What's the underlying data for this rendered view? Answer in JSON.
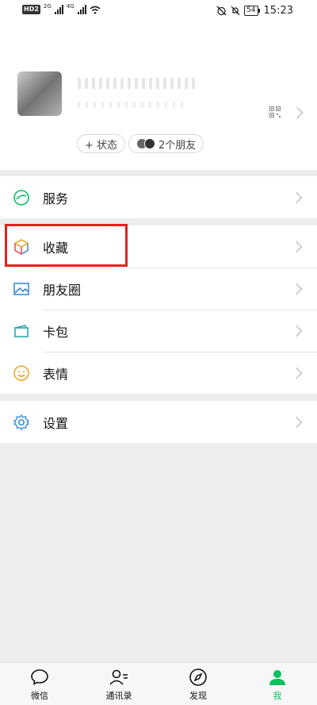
{
  "status_bar": {
    "hd": "HD",
    "hd_num": "2",
    "net1": "2G",
    "net2": "4G",
    "battery": "54",
    "time": "15:23"
  },
  "profile": {
    "status_chip": "+ 状态",
    "friends_chip": "2个朋友"
  },
  "menu": {
    "services": "服务",
    "favorites": "收藏",
    "moments": "朋友圈",
    "cards": "卡包",
    "stickers": "表情",
    "settings": "设置"
  },
  "tabs": [
    {
      "label": "微信",
      "icon": "chat-bubble-icon"
    },
    {
      "label": "通讯录",
      "icon": "contacts-icon"
    },
    {
      "label": "发现",
      "icon": "compass-icon"
    },
    {
      "label": "我",
      "icon": "person-icon",
      "active": true
    }
  ],
  "colors": {
    "accent": "#07c160",
    "highlight": "#e8201d"
  }
}
